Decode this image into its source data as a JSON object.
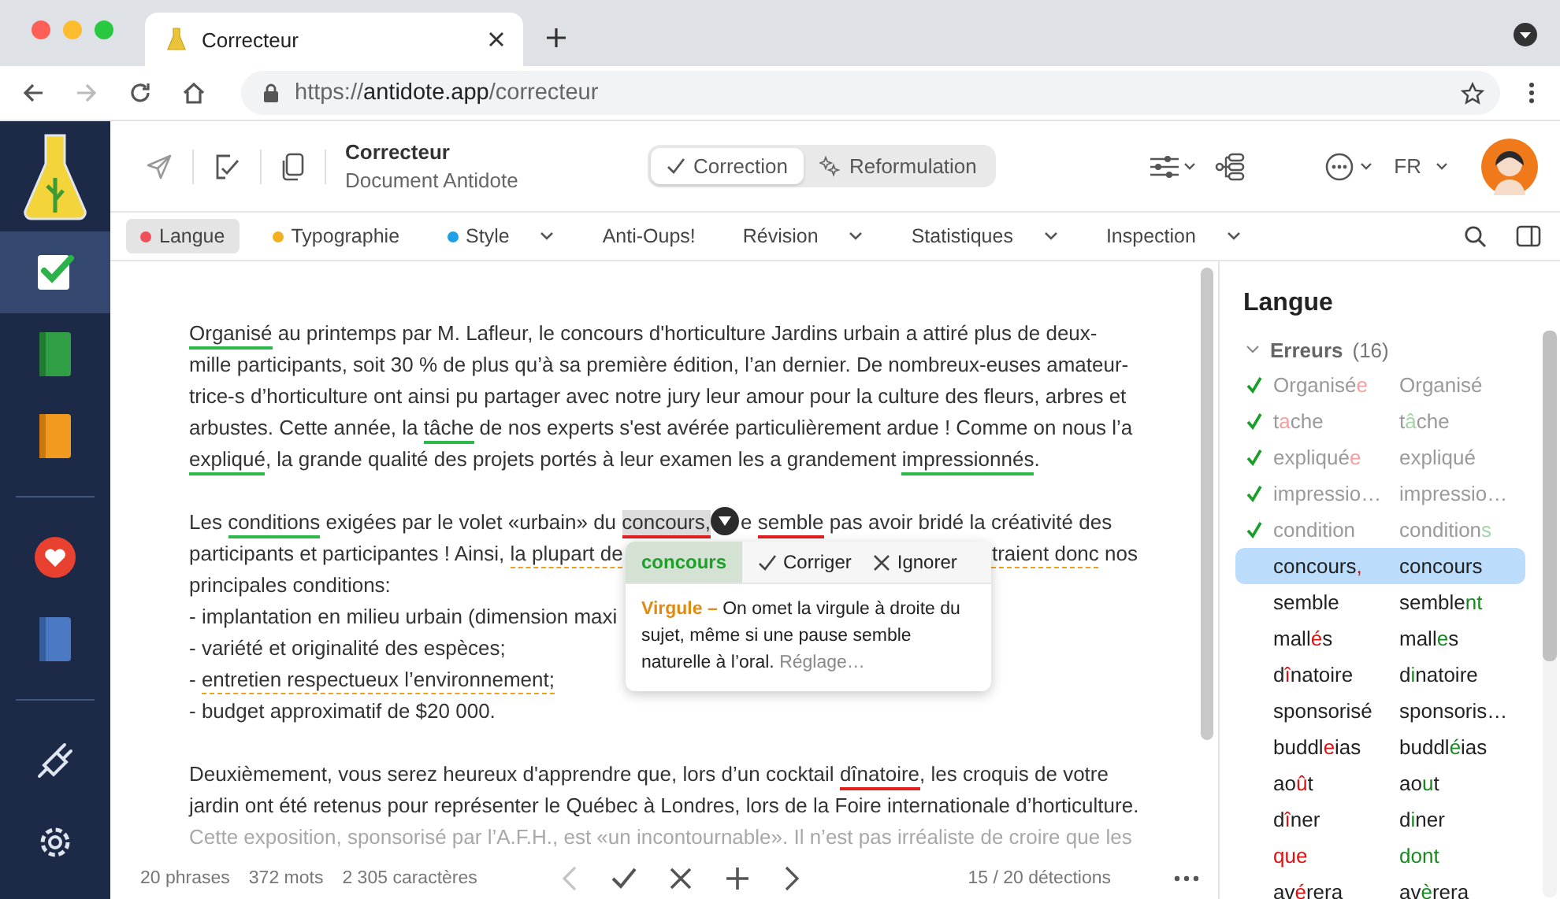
{
  "browser": {
    "tab_title": "Correcteur",
    "url": {
      "scheme": "https://",
      "host": "antidote.app",
      "path": "/correcteur"
    }
  },
  "sidebar": {
    "groups": [
      [
        {
          "kind": "corrector",
          "selected": true
        },
        {
          "kind": "green-book",
          "selected": false
        },
        {
          "kind": "orange-book",
          "selected": false
        }
      ],
      [
        {
          "kind": "heart",
          "selected": false
        },
        {
          "kind": "blue-book",
          "selected": false
        }
      ],
      [
        {
          "kind": "plug",
          "selected": false
        },
        {
          "kind": "settings",
          "selected": false
        }
      ]
    ]
  },
  "toolbar": {
    "title": "Correcteur",
    "subtitle": "Document Antidote",
    "modes": [
      {
        "label": "Correction",
        "kind": "check",
        "selected": true
      },
      {
        "label": "Reformulation",
        "kind": "sparkle",
        "selected": false
      }
    ],
    "language": "FR"
  },
  "filters": [
    {
      "label": "Langue",
      "color": "#f0505a",
      "has_menu": false,
      "selected": true
    },
    {
      "label": "Typographie",
      "color": "#f0b020",
      "has_menu": false,
      "selected": false
    },
    {
      "label": "Style",
      "color": "#1ca0e8",
      "has_menu": true,
      "selected": false
    },
    {
      "label": "Anti-Oups!",
      "has_menu": false,
      "selected": false
    },
    {
      "label": "Révision",
      "has_menu": true,
      "selected": false
    },
    {
      "label": "Statistiques",
      "has_menu": true,
      "selected": false
    },
    {
      "label": "Inspection",
      "has_menu": true,
      "selected": false
    }
  ],
  "document": {
    "paragraphs": [
      [
        {
          "segments": [
            {
              "text": "Organisé",
              "kind": "resolved",
              "selected": false
            },
            " au printemps par M. Lafleur, le concours d'horticulture Jardins urbain a attiré plus de deux-"
          ]
        },
        {
          "segments": [
            "mille participants, soit 30 % de plus qu’à sa première édition, l’an dernier. De nombreux-euses amateur-"
          ]
        },
        {
          "segments": [
            "trice-s d’horticulture ont ainsi pu partager avec notre jury leur amour pour la culture des fleurs, arbres et"
          ]
        },
        {
          "segments": [
            "arbustes. Cette année, la ",
            {
              "text": "tâche",
              "kind": "resolved",
              "selected": false
            },
            " de nos experts s'est avérée particulièrement ardue ! Comme on nous l’a"
          ]
        },
        {
          "segments": [
            {
              "text": "expliqué",
              "kind": "resolved",
              "selected": false
            },
            ", la grande qualité des projets portés à leur examen les a grandement ",
            {
              "text": "impressionnés",
              "kind": "resolved",
              "selected": false
            },
            "."
          ]
        }
      ],
      [
        {
          "segments": [
            "Les ",
            {
              "text": "conditions",
              "kind": "resolved",
              "selected": false
            },
            " exigées par le volet «urbain» du ",
            {
              "text": "concours,",
              "kind": "error",
              "selected": true
            },
            "e ",
            {
              "text": "semble",
              "kind": "error",
              "selected": false
            },
            " pas avoir bridé la créativité des"
          ]
        },
        {
          "segments": [
            "participants et participantes ! Ainsi, ",
            {
              "text": "la plupart de",
              "kind": "style",
              "selected": false
            }
          ],
          "right_segments": [
            {
              "text": "traient donc",
              "kind": "style",
              "selected": false
            },
            " nos"
          ]
        },
        {
          "segments": [
            "principales conditions:"
          ]
        },
        {
          "segments": [
            "- implantation en milieu urbain (dimension maxi"
          ]
        },
        {
          "segments": [
            "- variété et originalité des espèces;"
          ]
        },
        {
          "segments": [
            "- ",
            {
              "text": "entretien respectueux l’environnement;",
              "kind": "style",
              "selected": false
            }
          ]
        },
        {
          "segments": [
            "- budget approximatif de $20 000."
          ]
        }
      ],
      [
        {
          "segments": [
            "Deuxièmement, vous serez heureux d'apprendre que, lors d’un cocktail ",
            {
              "text": "dînatoire",
              "kind": "error",
              "selected": false
            },
            ", les croquis de votre"
          ]
        },
        {
          "segments": [
            "jardin ont été retenus pour représenter le Québec à Londres, lors de la Foire internationale d’horticulture."
          ]
        }
      ]
    ],
    "fade_line": "Cette exposition, sponsorisé par l’A.F.H., est «un incontournable». Il n’est pas irréaliste de croire que les"
  },
  "popup": {
    "suggestion": "concours",
    "actions": [
      {
        "label": "Corriger",
        "kind": "accept"
      },
      {
        "label": "Ignorer",
        "kind": "ignore"
      }
    ],
    "category": "Virgule –",
    "text": "On omet la virgule à droite du sujet, même si une pause semble naturelle à l’oral.",
    "link": "Réglage…"
  },
  "status_bar": {
    "stats": [
      "20 phrases",
      "372 mots",
      "2 305 caractères"
    ],
    "nav": [
      {
        "kind": "previous",
        "disabled": true
      },
      {
        "kind": "accept",
        "disabled": false
      },
      {
        "kind": "ignore",
        "disabled": false
      },
      {
        "kind": "add",
        "disabled": false
      },
      {
        "kind": "next",
        "disabled": false
      }
    ],
    "detections": "15 / 20 détections"
  },
  "panel": {
    "title": "Langue",
    "group": {
      "label": "Erreurs",
      "count": "(16)",
      "expanded": true,
      "rows": [
        {
          "done": true,
          "selected": false,
          "error": [
            {
              "text": "Organisé",
              "changed": false
            },
            {
              "text": "e",
              "changed": true
            }
          ],
          "fix": [
            {
              "text": "Organisé",
              "changed": false
            }
          ]
        },
        {
          "done": true,
          "selected": false,
          "error": [
            {
              "text": "t",
              "changed": false
            },
            {
              "text": "a",
              "changed": true
            },
            {
              "text": "che",
              "changed": false
            }
          ],
          "fix": [
            {
              "text": "t",
              "changed": false
            },
            {
              "text": "â",
              "changed": true
            },
            {
              "text": "che",
              "changed": false
            }
          ]
        },
        {
          "done": true,
          "selected": false,
          "error": [
            {
              "text": "expliqué",
              "changed": false
            },
            {
              "text": "e",
              "changed": true
            }
          ],
          "fix": [
            {
              "text": "expliqué",
              "changed": false
            }
          ]
        },
        {
          "done": true,
          "selected": false,
          "error": [
            {
              "text": "impressio…",
              "changed": false
            }
          ],
          "fix": [
            {
              "text": "impressio…",
              "changed": false
            }
          ]
        },
        {
          "done": true,
          "selected": false,
          "error": [
            {
              "text": "condition",
              "changed": false
            }
          ],
          "fix": [
            {
              "text": "condition",
              "changed": false
            },
            {
              "text": "s",
              "changed": true
            }
          ]
        },
        {
          "done": false,
          "selected": true,
          "error": [
            {
              "text": "concours",
              "changed": false
            },
            {
              "text": ",",
              "changed": true
            }
          ],
          "fix": [
            {
              "text": "concours",
              "changed": false
            }
          ]
        },
        {
          "done": false,
          "selected": false,
          "error": [
            {
              "text": "semble",
              "changed": false
            }
          ],
          "fix": [
            {
              "text": "semble",
              "changed": false
            },
            {
              "text": "nt",
              "changed": true
            }
          ]
        },
        {
          "done": false,
          "selected": false,
          "error": [
            {
              "text": "mall",
              "changed": false
            },
            {
              "text": "é",
              "changed": true
            },
            {
              "text": "s",
              "changed": false
            }
          ],
          "fix": [
            {
              "text": "mall",
              "changed": false
            },
            {
              "text": "e",
              "changed": true
            },
            {
              "text": "s",
              "changed": false
            }
          ]
        },
        {
          "done": false,
          "selected": false,
          "error": [
            {
              "text": "d",
              "changed": false
            },
            {
              "text": "î",
              "changed": true
            },
            {
              "text": "natoire",
              "changed": false
            }
          ],
          "fix": [
            {
              "text": "d",
              "changed": false
            },
            {
              "text": "i",
              "changed": true
            },
            {
              "text": "natoire",
              "changed": false
            }
          ]
        },
        {
          "done": false,
          "selected": false,
          "error": [
            {
              "text": "sponsorisé",
              "changed": false
            }
          ],
          "fix": [
            {
              "text": "sponsoris…",
              "changed": false
            }
          ]
        },
        {
          "done": false,
          "selected": false,
          "error": [
            {
              "text": "buddl",
              "changed": false
            },
            {
              "text": "e",
              "changed": true
            },
            {
              "text": "ias",
              "changed": false
            }
          ],
          "fix": [
            {
              "text": "buddl",
              "changed": false
            },
            {
              "text": "é",
              "changed": true
            },
            {
              "text": "ias",
              "changed": false
            }
          ]
        },
        {
          "done": false,
          "selected": false,
          "error": [
            {
              "text": "ao",
              "changed": false
            },
            {
              "text": "û",
              "changed": true
            },
            {
              "text": "t",
              "changed": false
            }
          ],
          "fix": [
            {
              "text": "ao",
              "changed": false
            },
            {
              "text": "u",
              "changed": true
            },
            {
              "text": "t",
              "changed": false
            }
          ]
        },
        {
          "done": false,
          "selected": false,
          "error": [
            {
              "text": "d",
              "changed": false
            },
            {
              "text": "î",
              "changed": true
            },
            {
              "text": "ner",
              "changed": false
            }
          ],
          "fix": [
            {
              "text": "d",
              "changed": false
            },
            {
              "text": "i",
              "changed": true
            },
            {
              "text": "ner",
              "changed": false
            }
          ]
        },
        {
          "done": false,
          "selected": false,
          "error": [
            {
              "text": "que",
              "changed": true
            }
          ],
          "fix": [
            {
              "text": "dont",
              "changed": true
            }
          ]
        },
        {
          "done": false,
          "selected": false,
          "error": [
            {
              "text": "av",
              "changed": false
            },
            {
              "text": "é",
              "changed": true
            },
            {
              "text": "rera",
              "changed": false
            }
          ],
          "fix": [
            {
              "text": "av",
              "changed": false
            },
            {
              "text": "è",
              "changed": true
            },
            {
              "text": "rera",
              "changed": false
            }
          ]
        }
      ]
    }
  }
}
